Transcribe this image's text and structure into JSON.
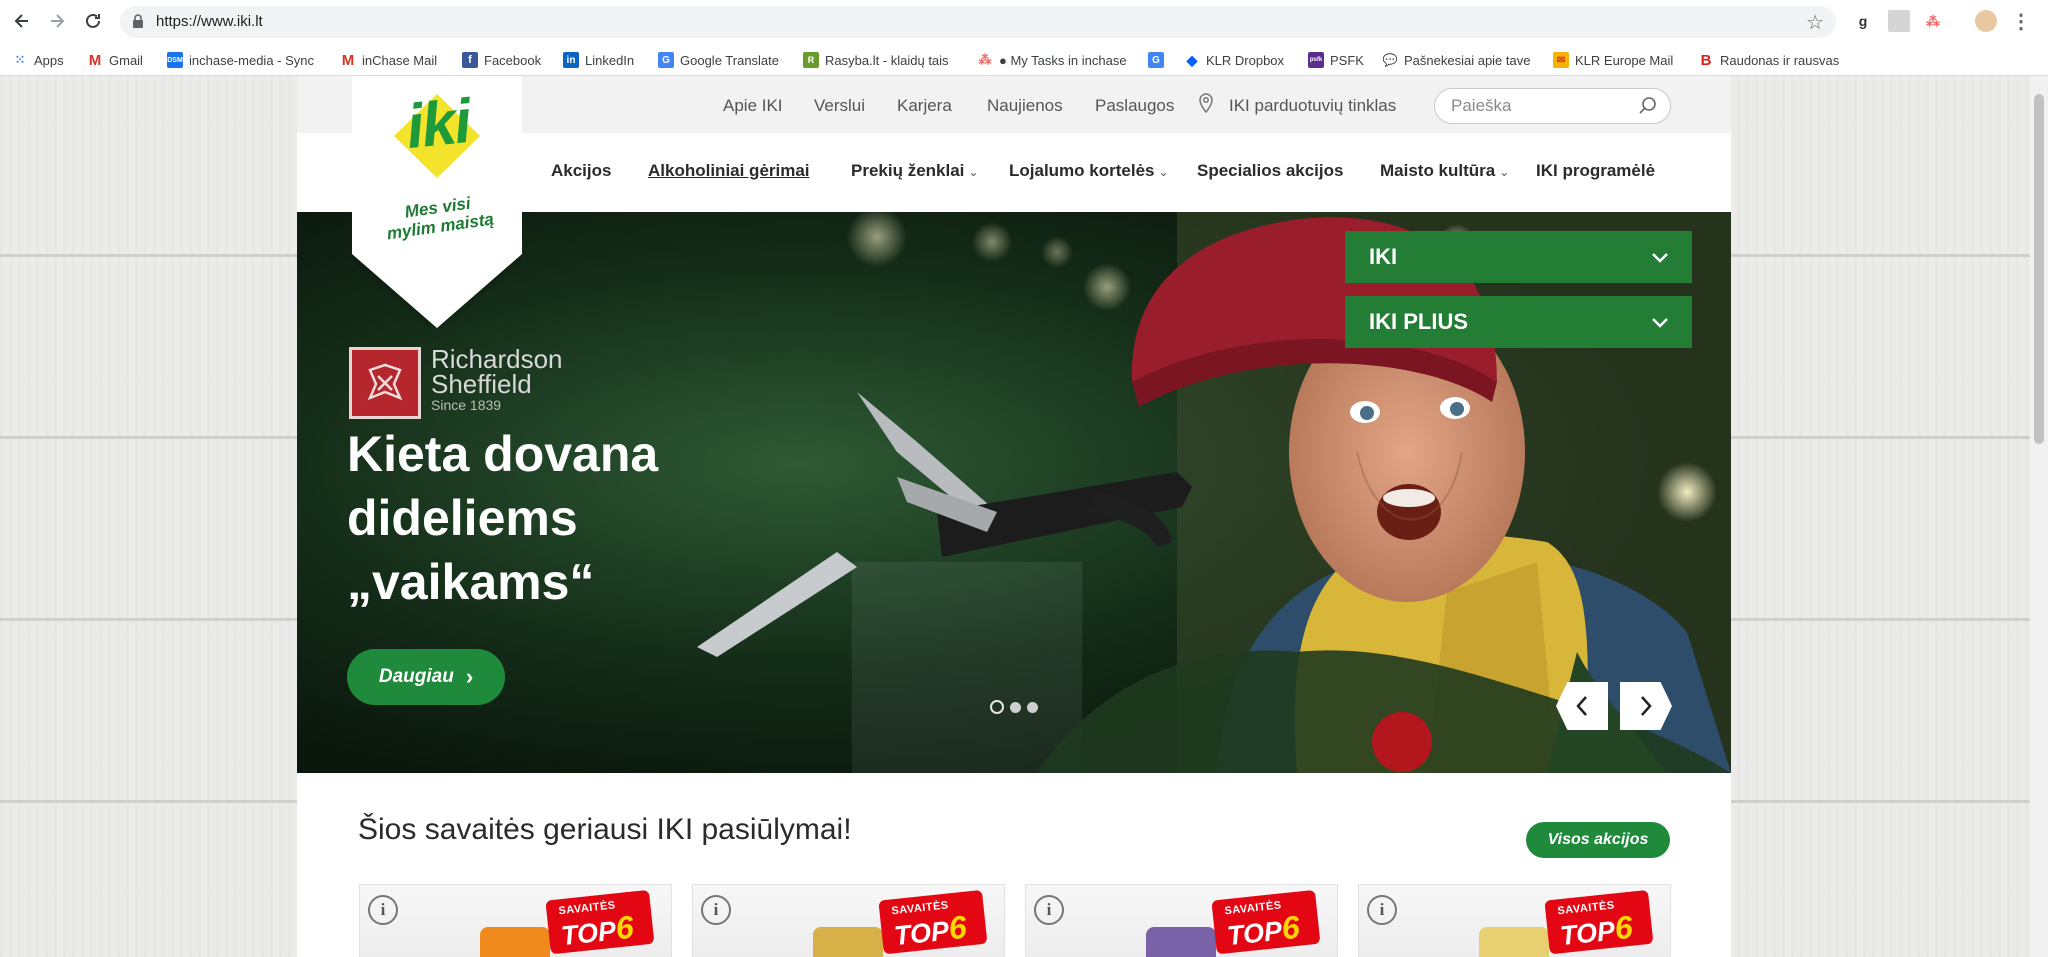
{
  "browser": {
    "url": "https://www.iki.lt",
    "bookmarks": [
      {
        "label": "Apps",
        "icon": "apps-grid-icon",
        "color": "#4285f4"
      },
      {
        "label": "Gmail",
        "icon": "gmail-icon",
        "color": "#d93025"
      },
      {
        "label": "inchase-media - Sync",
        "icon": "dsm-icon",
        "color": "#1a73e8"
      },
      {
        "label": "inChase Mail",
        "icon": "gmail-icon",
        "color": "#d93025"
      },
      {
        "label": "Facebook",
        "icon": "facebook-icon",
        "color": "#3b5998"
      },
      {
        "label": "LinkedIn",
        "icon": "linkedin-icon",
        "color": "#0a66c2"
      },
      {
        "label": "Google Translate",
        "icon": "translate-icon",
        "color": "#4285f4"
      },
      {
        "label": "Rasyba.lt - klaidų tais",
        "icon": "rasyba-icon",
        "color": "#6a9a2d"
      },
      {
        "label": "● My Tasks in inchase",
        "icon": "asana-icon",
        "color": "#f06a6a"
      },
      {
        "label": "",
        "icon": "translate-icon",
        "color": "#4285f4"
      },
      {
        "label": "KLR Dropbox",
        "icon": "dropbox-icon",
        "color": "#0061ff"
      },
      {
        "label": "PSFK",
        "icon": "psfk-icon",
        "color": "#5b2d8e"
      },
      {
        "label": "Pašnekesiai apie tave",
        "icon": "chat-icon",
        "color": "#4a90e2"
      },
      {
        "label": "KLR Europe Mail",
        "icon": "mail-icon",
        "color": "#f5b400"
      },
      {
        "label": "Raudonas ir rausvas",
        "icon": "b-icon",
        "color": "#e02020"
      }
    ]
  },
  "site": {
    "top_links": [
      "Apie IKI",
      "Verslui",
      "Karjera",
      "Naujienos",
      "Paslaugos",
      "IKI parduotuvių tinklas"
    ],
    "search_placeholder": "Paieška",
    "logo": {
      "word": "iki",
      "slogan_line1": "Mes visi",
      "slogan_line2": "mylim maistą"
    },
    "nav": [
      {
        "label": "Akcijos",
        "dropdown": false
      },
      {
        "label": "Alkoholiniai gėrimai",
        "dropdown": false
      },
      {
        "label": "Prekių ženklai",
        "dropdown": true
      },
      {
        "label": "Lojalumo kortelės",
        "dropdown": true
      },
      {
        "label": "Specialios akcijos",
        "dropdown": false
      },
      {
        "label": "Maisto kultūra",
        "dropdown": true
      },
      {
        "label": "IKI programėlė",
        "dropdown": false
      }
    ],
    "hero": {
      "brand_line1": "Richardson",
      "brand_line2": "Sheffield",
      "brand_since": "Since 1839",
      "headline_line1": "Kieta dovana",
      "headline_line2": "dideliems",
      "headline_line3": "„vaikams“",
      "cta": "Daugiau",
      "store_dropdowns": [
        "IKI",
        "IKI PLIUS"
      ],
      "slide_count": 3,
      "active_slide": 1
    },
    "offers": {
      "title": "Šios savaitės geriausi IKI pasiūlymai!",
      "all_button": "Visos akcijos",
      "tag_small": "SAVAITĖS",
      "tag_big": "TOP",
      "tag_num": "6",
      "cards": [
        {
          "product_color": "#f08a1c"
        },
        {
          "product_color": "#d8b048"
        },
        {
          "product_color": "#7a62a8"
        },
        {
          "product_color": "#e8d070"
        }
      ]
    },
    "colors": {
      "brand_green": "#1f8a3c",
      "logo_green": "#1e9a3a",
      "logo_yellow": "#f3e32a",
      "promo_red": "#e30613"
    }
  }
}
